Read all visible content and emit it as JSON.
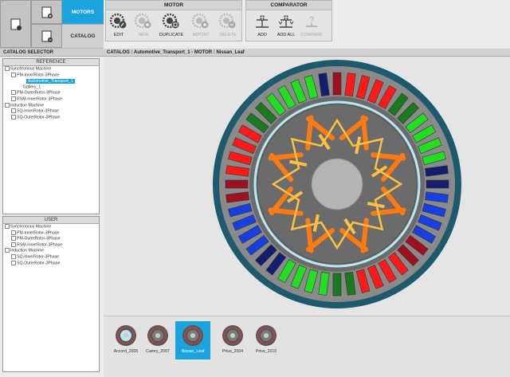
{
  "nav": {
    "motors_label": "MOTORS",
    "catalog_label": "CATALOG"
  },
  "ribbon": {
    "motor": {
      "title": "MOTOR",
      "tools": [
        {
          "label": "EDIT",
          "icon": "edit-motor-icon",
          "enabled": true
        },
        {
          "label": "NEW",
          "icon": "new-motor-icon",
          "enabled": false
        },
        {
          "label": "DUPLICATE",
          "icon": "duplicate-motor-icon",
          "enabled": true
        },
        {
          "label": "IMPORT",
          "icon": "import-motor-icon",
          "enabled": false
        },
        {
          "label": "DELETE",
          "icon": "delete-motor-icon",
          "enabled": false
        }
      ]
    },
    "comparator": {
      "title": "COMPARATOR",
      "tools": [
        {
          "label": "ADD",
          "icon": "balance-add-icon",
          "enabled": true
        },
        {
          "label": "ADD ALL",
          "icon": "balance-add-all-icon",
          "enabled": true
        },
        {
          "label": "COMPARE",
          "icon": "compare-icon",
          "enabled": false
        }
      ]
    }
  },
  "catalog_selector": {
    "title": "CATALOG SELECTOR",
    "reference": {
      "title": "REFERENCE",
      "items": [
        {
          "label": "Synchronous Machine",
          "level": 0,
          "selected": false
        },
        {
          "label": "PM-InnerRotor-3Phase",
          "level": 1,
          "selected": false
        },
        {
          "label": "Automotive_Transport_1",
          "level": 2,
          "selected": true
        },
        {
          "label": "Gallery_1",
          "level": 2,
          "selected": false
        },
        {
          "label": "PM-OuterRotor-3Phase",
          "level": 1,
          "selected": false
        },
        {
          "label": "RSM-InnerRotor-3Phase",
          "level": 1,
          "selected": false
        },
        {
          "label": "Induction Machine",
          "level": 0,
          "selected": false
        },
        {
          "label": "SQ-InnerRotor-3Phase",
          "level": 1,
          "selected": false
        },
        {
          "label": "SQ-OuterRotor-3Phase",
          "level": 1,
          "selected": false
        }
      ]
    },
    "user": {
      "title": "USER",
      "items": [
        {
          "label": "Synchronous Machine",
          "level": 0
        },
        {
          "label": "PM-InnerRotor-3Phase",
          "level": 1
        },
        {
          "label": "PM-OuterRotor-3Phase",
          "level": 1
        },
        {
          "label": "RSM-InnerRotor-3Phase",
          "level": 1
        },
        {
          "label": "Induction Machine",
          "level": 0
        },
        {
          "label": "SQ-InnerRotor-3Phase",
          "level": 1
        },
        {
          "label": "SQ-OuterRotor-3Phase",
          "level": 1
        }
      ]
    }
  },
  "catalog_header": "CATALOG : Automotive_Transport_1  -  MOTOR : Nissan_Leaf",
  "motor_colors": {
    "frame": "#1e5a6e",
    "stator": "#8a8a8a",
    "rotor": "#6b6b6b",
    "shaft": "#b4b4b4",
    "phase_red": "#ff1a1a",
    "phase_dark_red": "#a01020",
    "phase_green": "#22dd22",
    "phase_dark_green": "#1a7a20",
    "phase_blue": "#1840e0",
    "phase_navy": "#141e6e",
    "magnet_orange": "#ff7a10",
    "magnet_yellow": "#ffc040",
    "airgap": "#b8e6f2"
  },
  "thumbnails": [
    {
      "label": "Accord_2005",
      "active": false
    },
    {
      "label": "Camry_2007",
      "active": false
    },
    {
      "label": "Nissan_Leaf",
      "active": true
    },
    {
      "label": "Prius_2004",
      "active": false
    },
    {
      "label": "Prius_2010",
      "active": false
    }
  ]
}
